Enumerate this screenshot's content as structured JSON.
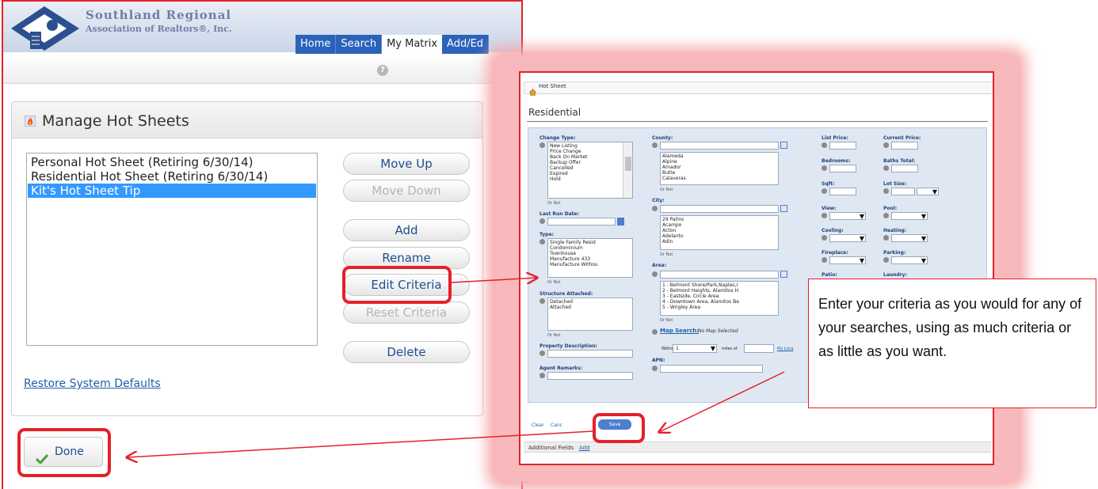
{
  "brand": {
    "line1": "Southland Regional",
    "line2": "Association of Realtors®, Inc."
  },
  "nav": {
    "tabs": [
      "Home",
      "Search",
      "My Matrix",
      "Add/Ed"
    ],
    "active": "My Matrix"
  },
  "manage": {
    "title": "Manage Hot Sheets",
    "list_items": [
      "Personal Hot Sheet (Retiring 6/30/14)",
      "Residential Hot Sheet (Retiring 6/30/14)",
      "Kit's Hot Sheet Tip"
    ],
    "selected_item": "Kit's Hot Sheet Tip",
    "buttons": {
      "move_up": "Move Up",
      "move_down": "Move Down",
      "add": "Add",
      "rename": "Rename",
      "edit_criteria": "Edit Criteria",
      "reset_criteria": "Reset Criteria",
      "delete": "Delete"
    },
    "restore_link": "Restore System Defaults",
    "done": "Done"
  },
  "criteria": {
    "breadcrumb": "Hot Sheet",
    "title": "Residential",
    "or_not": "Or   Not",
    "change_type": {
      "label": "Change Type:",
      "options": [
        "New Listing",
        "Price Change",
        "Back On Market",
        "Backup Offer",
        "Cancelled",
        "Expired",
        "Hold"
      ]
    },
    "last_run_date": {
      "label": "Last Run Date:"
    },
    "type": {
      "label": "Type:",
      "options": [
        "Single Family Resid",
        "Condominium",
        "Townhouse",
        "Manufacture 433",
        "Manufacture Withou"
      ]
    },
    "structure_attached": {
      "label": "Structure Attached:",
      "options": [
        "Detached",
        "Attached"
      ]
    },
    "property_description": {
      "label": "Property Description:"
    },
    "agent_remarks": {
      "label": "Agent Remarks:"
    },
    "county": {
      "label": "County:",
      "options": [
        "Alameda",
        "Alpine",
        "Amador",
        "Butte",
        "Calaveras"
      ]
    },
    "city": {
      "label": "City:",
      "options": [
        "29 Palms",
        "Acampo",
        "Acton",
        "Adelanto",
        "Adin"
      ]
    },
    "area": {
      "label": "Area:",
      "options": [
        "1 - Belmont Shore/Park,Naples,I",
        "2 - Belmont Heights, Alamitos H",
        "3 - Eastside, Circle Area",
        "4 - Downtown Area, Alamitos Be",
        "5 - Wrigley Area"
      ]
    },
    "map_search": {
      "label": "Map Search:",
      "status": "No Map Selected",
      "within": "Within",
      "within_value": "1",
      "miles_of": "miles of",
      "my_location": "My Loca"
    },
    "apn": {
      "label": "APN:"
    },
    "right_fields": [
      "List Price:",
      "Current Price:",
      "Bedrooms:",
      "Baths Total:",
      "Sqft:",
      "Lot Size:",
      "View:",
      "Pool:",
      "Cooling:",
      "Heating:",
      "Fireplace:",
      "Parking:",
      "Patio:",
      "Laundry:"
    ],
    "clear": "Clear",
    "cancel": "Canc",
    "save": "Save",
    "additional_fields": "Additional Fields",
    "additional_add": "Add"
  },
  "callout": {
    "text": "Enter your criteria as you would for any of your searches, using as much criteria or as little as you want."
  },
  "colors": {
    "highlight": "#e5202a",
    "nav_blue": "#2a63b9",
    "selection": "#3399ff",
    "link": "#1f5fa8"
  }
}
